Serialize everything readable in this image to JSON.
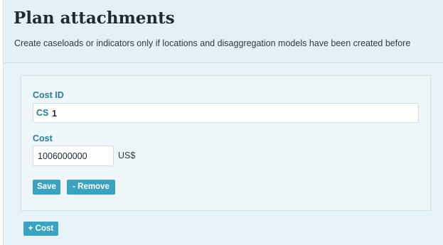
{
  "header": {
    "title": "Plan attachments",
    "subtitle": "Create caseloads or indicators only if locations and disaggregation models have been created before"
  },
  "cost_item": {
    "cost_id_label": "Cost ID",
    "cost_id_prefix": "CS",
    "cost_id_value": "1",
    "cost_label": "Cost",
    "cost_value": "1006000000",
    "currency": "US$",
    "save_label": "Save",
    "remove_label": "- Remove"
  },
  "actions": {
    "add_cost_label": "+ Cost"
  },
  "colors": {
    "accent": "#3aa3c2",
    "label_text": "#2a7d96",
    "panel_background": "#e3f0f5"
  }
}
